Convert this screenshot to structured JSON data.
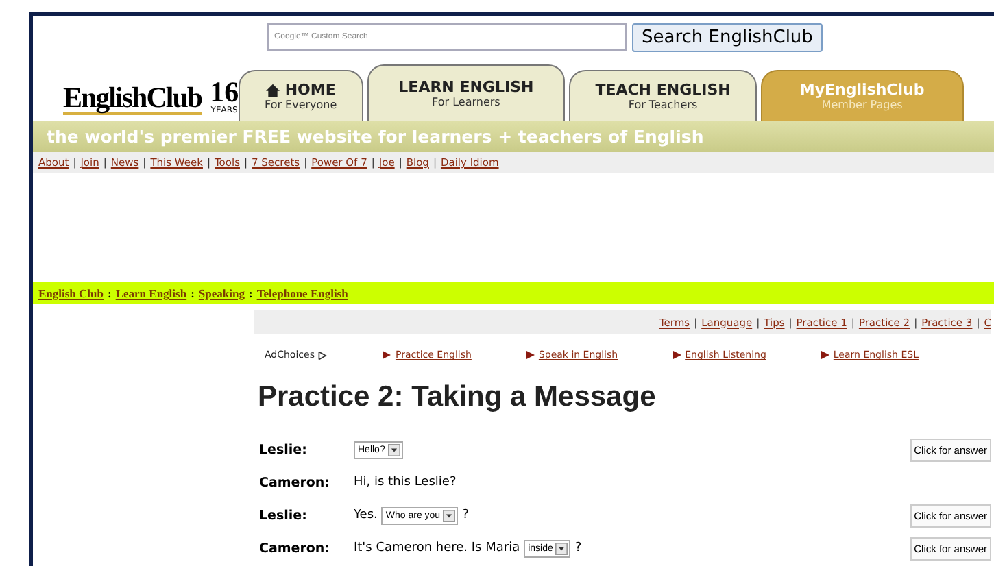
{
  "search": {
    "placeholder": "Google™ Custom Search",
    "button": "Search EnglishClub"
  },
  "logo": {
    "name": "EnglishClub",
    "years": "16",
    "years_label": "YEARS"
  },
  "tabs": [
    {
      "label": "HOME",
      "sub": "For Everyone",
      "icon": true,
      "kind": "plain"
    },
    {
      "label": "LEARN ENGLISH",
      "sub": "For Learners",
      "icon": false,
      "kind": "plain"
    },
    {
      "label": "TEACH ENGLISH",
      "sub": "For Teachers",
      "icon": false,
      "kind": "plain"
    },
    {
      "label": "MyEnglishClub",
      "sub": "Member Pages",
      "icon": false,
      "kind": "member"
    }
  ],
  "tagline": "the world's premier FREE website for learners + teachers of English",
  "link_separator": "|",
  "breadcrumb_separator": ":",
  "top_links": [
    "About",
    "Join",
    "News",
    "This Week",
    "Tools",
    "7 Secrets",
    "Power Of 7",
    "Joe",
    "Blog",
    "Daily Idiom"
  ],
  "breadcrumb": [
    "English Club",
    "Learn English",
    "Speaking",
    "Telephone English"
  ],
  "page_links": [
    "Terms",
    "Language",
    "Tips",
    "Practice 1",
    "Practice 2",
    "Practice 3",
    "C"
  ],
  "adchoices": "AdChoices",
  "ad_links": [
    "Practice English",
    "Speak in English",
    "English Listening",
    "Learn English ESL"
  ],
  "heading": "Practice 2: Taking a Message",
  "dialogue": [
    {
      "speaker": "Leslie:",
      "parts": [
        {
          "kind": "select",
          "text": "Hello?"
        }
      ],
      "answer": "Click for answer"
    },
    {
      "speaker": "Cameron:",
      "parts": [
        {
          "kind": "text",
          "text": "Hi, is this Leslie?"
        }
      ]
    },
    {
      "speaker": "Leslie:",
      "parts": [
        {
          "kind": "text",
          "text": "Yes."
        },
        {
          "kind": "select",
          "text": "Who are you"
        },
        {
          "kind": "text",
          "text": "?"
        }
      ],
      "answer": "Click for answer"
    },
    {
      "speaker": "Cameron:",
      "parts": [
        {
          "kind": "text",
          "text": "It's Cameron here. Is Maria"
        },
        {
          "kind": "select",
          "text": "inside"
        },
        {
          "kind": "text",
          "text": "?"
        }
      ],
      "answer": "Click for answer"
    }
  ]
}
